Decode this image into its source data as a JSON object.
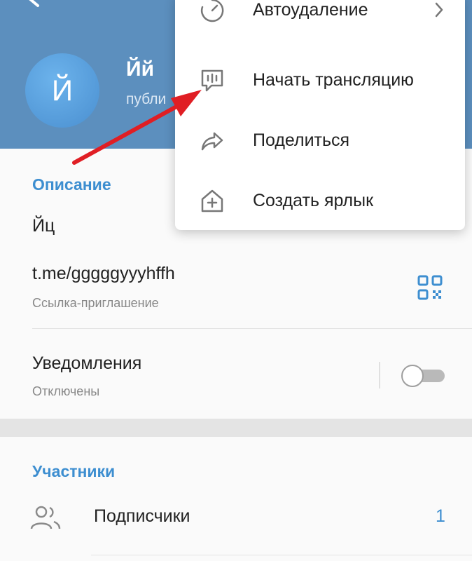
{
  "header": {
    "avatar_letter": "Й",
    "title": "Йй",
    "subtitle": "публи"
  },
  "menu": {
    "items": [
      {
        "label": "Автоудаление",
        "icon": "timer-icon",
        "has_chevron": true
      },
      {
        "label": "Начать трансляцию",
        "icon": "broadcast-icon"
      },
      {
        "label": "Поделиться",
        "icon": "share-icon"
      },
      {
        "label": "Создать ярлык",
        "icon": "add-shortcut-icon"
      }
    ]
  },
  "about": {
    "section_title": "Описание",
    "description": "Йц",
    "link": "t.me/gggggyyyhffh",
    "link_caption": "Ссылка-приглашение",
    "notifications_label": "Уведомления",
    "notifications_status": "Отключены",
    "notifications_enabled": false
  },
  "members": {
    "section_title": "Участники",
    "subscribers_label": "Подписчики",
    "subscribers_count": "1"
  },
  "colors": {
    "header": "#5c8fbe",
    "accent": "#3d8ed0",
    "annotation_arrow": "#e01e24"
  }
}
